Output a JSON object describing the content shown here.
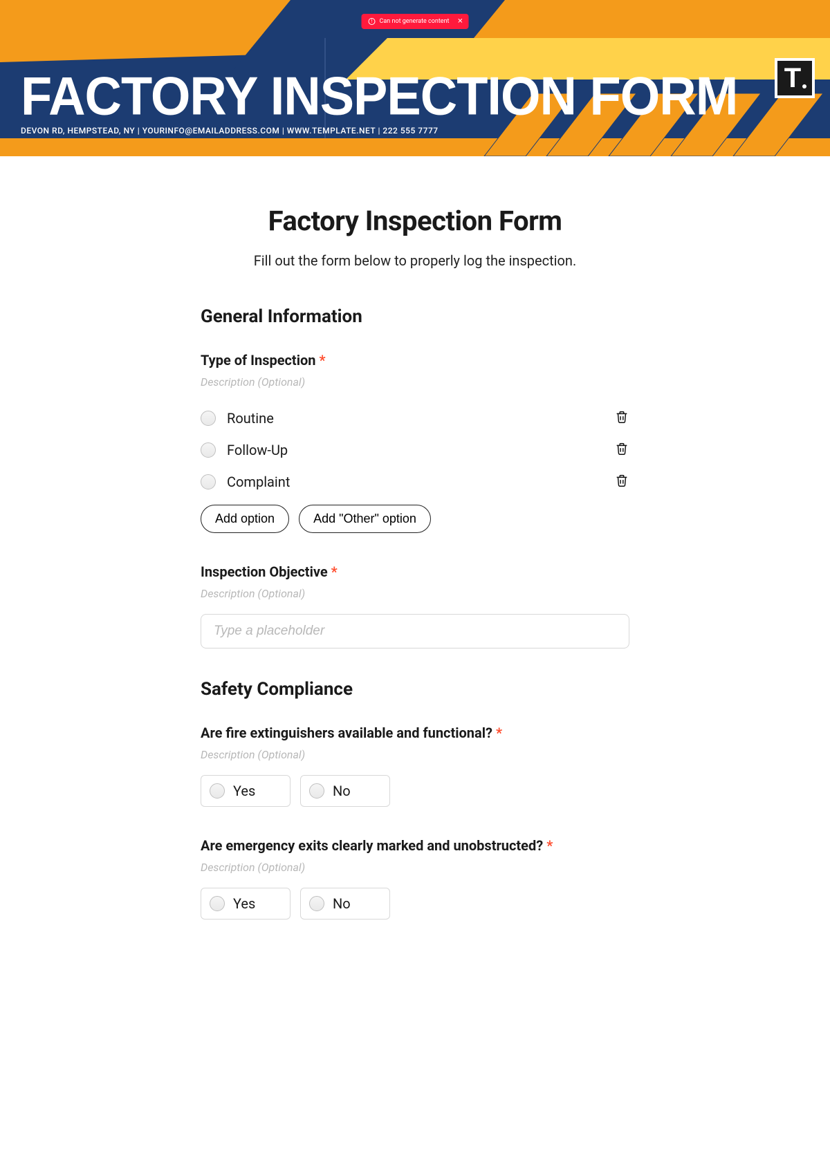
{
  "toast": {
    "message": "Can not generate content"
  },
  "banner": {
    "title": "FACTORY INSPECTION FORM",
    "subtitle": "DEVON RD, HEMPSTEAD, NY | YOURINFO@EMAILADDRESS.COM | WWW.TEMPLATE.NET | 222 555 7777",
    "logo_text": "T"
  },
  "form": {
    "title": "Factory Inspection Form",
    "description": "Fill out the form below to properly log the inspection.",
    "desc_placeholder": "Description (Optional)",
    "input_placeholder": "Type a placeholder",
    "add_option": "Add option",
    "add_other": "Add \"Other\" option",
    "sections": {
      "general": {
        "heading": "General Information",
        "type_of_inspection": {
          "label": "Type of Inspection",
          "options": [
            "Routine",
            "Follow-Up",
            "Complaint"
          ]
        },
        "inspection_objective": {
          "label": "Inspection Objective"
        }
      },
      "safety": {
        "heading": "Safety Compliance",
        "q1": {
          "label": "Are fire extinguishers available and functional?",
          "options": [
            "Yes",
            "No"
          ]
        },
        "q2": {
          "label": "Are emergency exits clearly marked and unobstructed?",
          "options": [
            "Yes",
            "No"
          ]
        }
      }
    }
  }
}
